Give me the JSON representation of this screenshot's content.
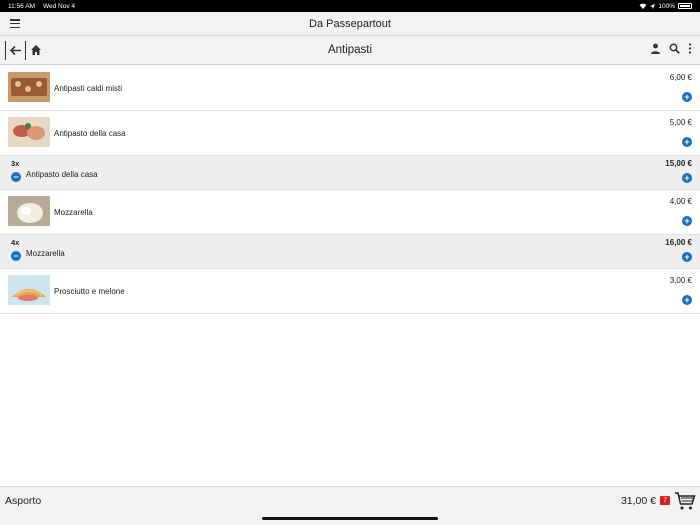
{
  "status": {
    "time": "11:56 AM",
    "date": "Wed Nov 4",
    "battery": "100%"
  },
  "app": {
    "title": "Da Passepartout"
  },
  "nav": {
    "title": "Antipasti"
  },
  "icons": {
    "menu": "hamburger-icon",
    "back": "back-arrow-icon",
    "home": "home-icon",
    "account": "person-icon",
    "search": "search-icon",
    "more": "more-vert-icon",
    "add": "plus-icon",
    "remove": "minus-icon",
    "cart": "shopping-cart-icon"
  },
  "colors": {
    "accent": "#1a6fc0",
    "badge": "#d81e1e"
  },
  "rows": [
    {
      "type": "product",
      "name": "Antipasti caldi misti",
      "price": "6,00 €"
    },
    {
      "type": "product",
      "name": "Antipasto della casa",
      "price": "5,00 €"
    },
    {
      "type": "cart",
      "qty": "3x",
      "name": "Antipasto della casa",
      "price": "15,00 €"
    },
    {
      "type": "product",
      "name": "Mozzarella",
      "price": "4,00 €"
    },
    {
      "type": "cart",
      "qty": "4x",
      "name": "Mozzarella",
      "price": "16,00 €"
    },
    {
      "type": "product",
      "name": "Prosciutto e melone",
      "price": "3,00 €"
    }
  ],
  "footer": {
    "mode": "Asporto",
    "total": "31,00 €",
    "count": "7"
  }
}
